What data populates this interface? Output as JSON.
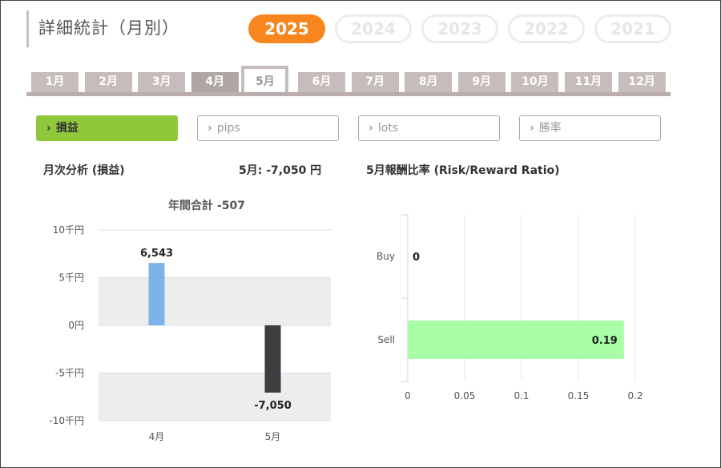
{
  "page_title": "詳細統計（月別）",
  "years": [
    {
      "label": "2025",
      "active": true
    },
    {
      "label": "2024",
      "active": false
    },
    {
      "label": "2023",
      "active": false
    },
    {
      "label": "2022",
      "active": false
    },
    {
      "label": "2021",
      "active": false
    }
  ],
  "months": [
    {
      "label": "1月",
      "active": false
    },
    {
      "label": "2月",
      "active": false
    },
    {
      "label": "3月",
      "active": false
    },
    {
      "label": "4月",
      "active": false
    },
    {
      "label": "5月",
      "active": true
    },
    {
      "label": "6月",
      "active": false
    },
    {
      "label": "7月",
      "active": false
    },
    {
      "label": "8月",
      "active": false
    },
    {
      "label": "9月",
      "active": false
    },
    {
      "label": "10月",
      "active": false
    },
    {
      "label": "11月",
      "active": false
    },
    {
      "label": "12月",
      "active": false
    }
  ],
  "categories": [
    {
      "label": "損益",
      "active": true
    },
    {
      "label": "pips",
      "active": false
    },
    {
      "label": "lots",
      "active": false
    },
    {
      "label": "勝率",
      "active": false
    }
  ],
  "monthly_analysis_label": "月次分析 (損益)",
  "monthly_value_label": "5月:  -7,050 円",
  "rr_title": "5月報酬比率 (Risk/Reward Ratio)",
  "colors": {
    "accent_orange": "#f7861f",
    "accent_green": "#8fc93a",
    "bar_positive": "#7cb4e8",
    "bar_negative": "#3d3d42",
    "rr_bar": "#a8ffa8"
  },
  "chart_data": [
    {
      "type": "bar",
      "subtitle": "年間合計 -507",
      "categories": [
        "4月",
        "5月"
      ],
      "values": [
        6543,
        -7050
      ],
      "data_labels": [
        "6,543",
        "-7,050"
      ],
      "ylim": [
        -10000,
        10000
      ],
      "yticks": [
        10000,
        5000,
        0,
        -5000,
        -10000
      ],
      "ytick_labels": [
        "10千円",
        "5千円",
        "0円",
        "-5千円",
        "-10千円"
      ],
      "grid": true
    },
    {
      "type": "bar",
      "orientation": "horizontal",
      "categories": [
        "Buy",
        "Sell"
      ],
      "values": [
        0,
        0.19
      ],
      "data_labels": [
        "0",
        "0.19"
      ],
      "xlim": [
        0,
        0.2
      ],
      "xticks": [
        0,
        0.05,
        0.1,
        0.15,
        0.2
      ],
      "xtick_labels": [
        "0",
        "0.05",
        "0.1",
        "0.15",
        "0.2"
      ],
      "grid": true
    }
  ]
}
